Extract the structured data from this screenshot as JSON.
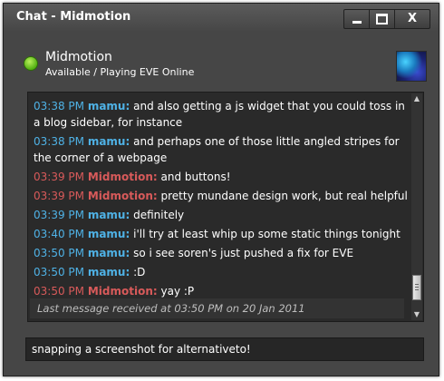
{
  "window": {
    "title": "Chat - Midmotion",
    "minimize_icon": "minimize-icon",
    "maximize_icon": "maximize-icon",
    "close_icon": "close-icon",
    "close_glyph": "X"
  },
  "contact": {
    "name": "Midmotion",
    "status": "Available / Playing EVE Online",
    "status_color": "#52b012"
  },
  "colors": {
    "mamu": "#4fb2e6",
    "midmotion": "#d85a5a"
  },
  "messages": [
    {
      "time": "03:38 PM",
      "sender": "mamu:",
      "text": "and also getting a js widget that you could toss in a blog sidebar, for instance",
      "who": "mamu"
    },
    {
      "time": "03:38 PM",
      "sender": "mamu:",
      "text": "and perhaps one of those little angled stripes for the corner of a webpage",
      "who": "mamu"
    },
    {
      "time": "03:39 PM",
      "sender": "Midmotion:",
      "text": "and buttons!",
      "who": "mid"
    },
    {
      "time": "03:39 PM",
      "sender": "Midmotion:",
      "text": "pretty mundane design work, but real helpful",
      "who": "mid"
    },
    {
      "time": "03:39 PM",
      "sender": "mamu:",
      "text": "definitely",
      "who": "mamu"
    },
    {
      "time": "03:40 PM",
      "sender": "mamu:",
      "text": "i'll try at least whip up some static things tonight",
      "who": "mamu"
    },
    {
      "time": "03:50 PM",
      "sender": "mamu:",
      "text": "so i see soren's just pushed a fix for EVE",
      "who": "mamu"
    },
    {
      "time": "03:50 PM",
      "sender": "mamu:",
      "text": ":D",
      "who": "mamu"
    },
    {
      "time": "03:50 PM",
      "sender": "Midmotion:",
      "text": "yay :P",
      "who": "mid"
    }
  ],
  "last_message_note": "Last message received at 03:50 PM on 20 Jan 2011",
  "input": {
    "value": "snapping a screenshot for alternativeto!"
  }
}
